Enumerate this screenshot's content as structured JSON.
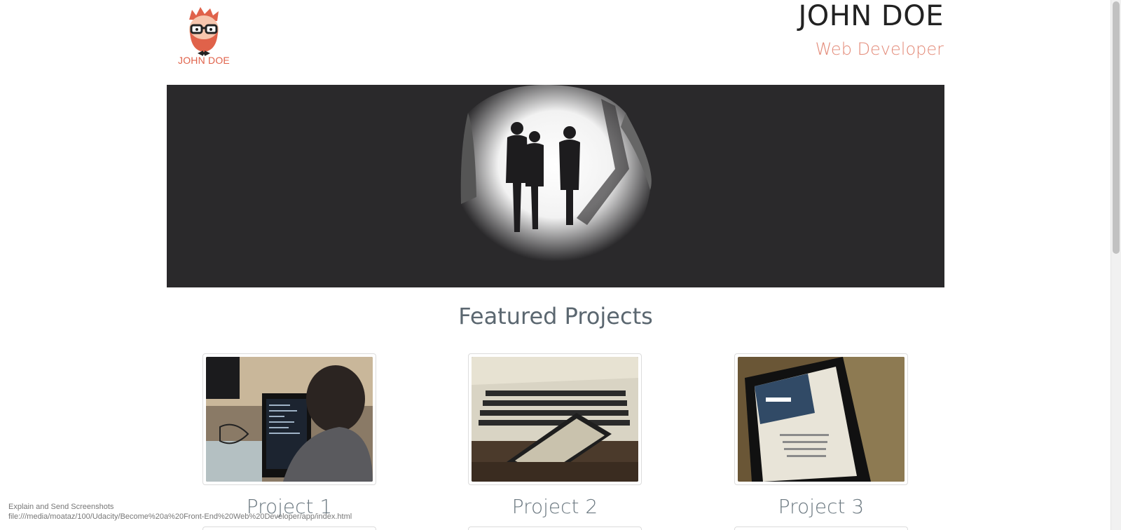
{
  "header": {
    "logo_text": "JOHN DOE",
    "name": "JOHN DOE",
    "role": "Web Developer"
  },
  "hero": {
    "icon": "silhouettes-in-cave-image"
  },
  "featured": {
    "title": "Featured Projects"
  },
  "projects": [
    {
      "title": "Project 1",
      "thumb": "person-coding-laptop-image"
    },
    {
      "title": "Project 2",
      "thumb": "smartphone-on-laptop-image"
    },
    {
      "title": "Project 3",
      "thumb": "tablet-welcome-screen-image"
    }
  ],
  "status": {
    "label": "Explain and Send Screenshots",
    "url": "file:///media/moataz/100/Udacity/Become%20a%20Front-End%20Web%20Developer/app/index.html"
  },
  "colors": {
    "accent": "#e0624a",
    "role": "#e38a78",
    "hero_bg": "#2a292b",
    "heading": "#5b6770"
  }
}
